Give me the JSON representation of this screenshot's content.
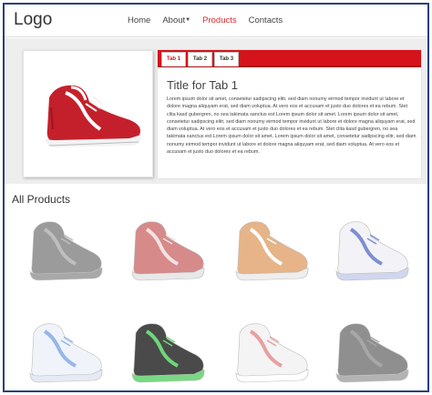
{
  "navbar": {
    "logo": "Logo",
    "items": [
      {
        "label": "Home",
        "active": false
      },
      {
        "label": "About",
        "active": false,
        "dropdown": true
      },
      {
        "label": "Products",
        "active": true
      },
      {
        "label": "Contacts",
        "active": false
      }
    ]
  },
  "featured": {
    "icon": "red-sneaker-image",
    "tabs": [
      {
        "label": "Tab 1",
        "active": true
      },
      {
        "label": "Tab 2",
        "active": false
      },
      {
        "label": "Tab 3",
        "active": false
      }
    ],
    "title": "Title for Tab 1",
    "body": "Lorem ipsum dolor sit amet, consetetur sadipscing elitr, sed diam nonumy eirmod tempor invidunt ut labore et dolore magna aliquyam erat, sed diam voluptua. At vero eos et accusam et justo duo dolores et ea rebum. Stet clita kasd gubergren, no sea takimata sanctus est Lorem ipsum dolor sit amet. Lorem ipsum dolor sit amet, consetetur sadipscing elitr, sed diam nonumy eirmod tempor invidunt ut labore et dolore magna aliquyam erat, sed diam voluptua. At vero eos et accusam et justo duo dolores et ea rebum. Stet clita kasd gubergren, no sea takimata sanctus est Lorem ipsum dolor sit amet. Lorem ipsum dolor sit amet, consetetur sadipscing elitr, sed diam nonumy eirmod tempor invidunt ut labore et dolore magna aliquyam erat, sed diam voluptua. At vero eos et accusam et justo duo dolores et ea rebum."
  },
  "products": {
    "heading": "All Products",
    "items": [
      {
        "icon": "grey-sneaker-image",
        "body": "#7a7a7a",
        "accent": "#a9a9a9",
        "sole": "#8c8c8c"
      },
      {
        "icon": "red-sneaker-image",
        "body": "#d68a8a",
        "accent": "#f4e2e2",
        "sole": "#e8e8e8"
      },
      {
        "icon": "orange-sneaker-image",
        "body": "#e6b488",
        "accent": "#ffffff",
        "sole": "#eeeeee"
      },
      {
        "icon": "blue-white-sneaker-image",
        "body": "#f3f3f7",
        "accent": "#7d8fd0",
        "sole": "#d0d6ee"
      },
      {
        "icon": "light-blue-sneaker-image",
        "body": "#f0f4fa",
        "accent": "#96b6e8",
        "sole": "#e6eaf4"
      },
      {
        "icon": "green-black-sneaker-image",
        "body": "#4a4a4a",
        "accent": "#6fd77a",
        "sole": "#79d884"
      },
      {
        "icon": "white-red-sneaker-image",
        "body": "#f4f4f4",
        "accent": "#e7a0a0",
        "sole": "#ffffff"
      },
      {
        "icon": "dark-grey-sneaker-image",
        "body": "#6a6a6a",
        "accent": "#8a8a8a",
        "sole": "#9a9a9a"
      }
    ]
  },
  "colors": {
    "accent": "#d4131b",
    "nav_active": "#d7292d",
    "frame_border": "#27407a"
  }
}
